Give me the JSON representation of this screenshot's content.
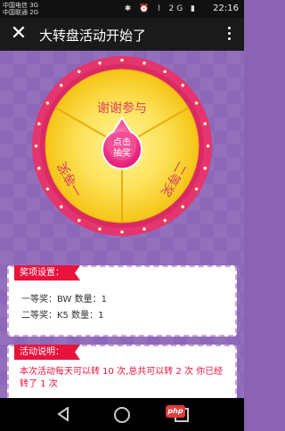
{
  "status_bar": {
    "carrier_1": "中国电信 3G",
    "carrier_2": "中国联通 2G",
    "icons": "✱ ⏰ ⌇ 2G ▮",
    "time": "22:16"
  },
  "title_bar": {
    "close_glyph": "✕",
    "title": "大转盘活动开始了"
  },
  "wheel": {
    "top_label": "谢谢参与",
    "left_label": "一等奖",
    "right_label": "二等奖",
    "button_label_line1": "点击",
    "button_label_line2": "抽奖",
    "colors": {
      "rim": "#e5356f",
      "face": "#f7d21a",
      "face_inner": "#fde66a",
      "button": "#f1388a"
    }
  },
  "prize_panel": {
    "heading": "奖项设置：",
    "lines": [
      "一等奖：BW 数量：1",
      "二等奖：K5 数量：1"
    ]
  },
  "activity_panel": {
    "heading": "活动说明：",
    "text": "本次活动每天可以转 10 次,总共可以转 2 次 你已经转了 1 次"
  },
  "watermark": "php"
}
